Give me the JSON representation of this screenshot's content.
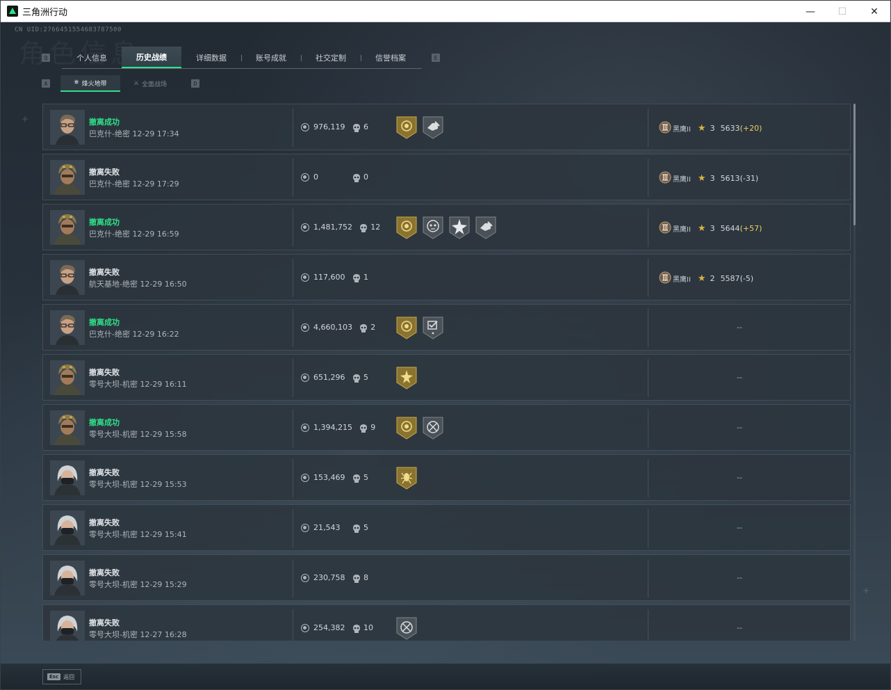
{
  "window": {
    "title": "三角洲行动",
    "minimize": "—",
    "maximize": "☐",
    "close": "✕"
  },
  "uid": "CN UID:2766451554683787500",
  "watermark": "角色信息",
  "keys": {
    "left_tab": "Q",
    "right_tab": "E",
    "left_sub": "A",
    "right_sub": "D"
  },
  "tabs": [
    {
      "label": "个人信息",
      "active": false
    },
    {
      "label": "历史战绩",
      "active": true
    },
    {
      "label": "详细数据",
      "active": false
    },
    {
      "label": "账号成就",
      "active": false
    },
    {
      "label": "社交定制",
      "active": false
    },
    {
      "label": "信誉档案",
      "active": false
    }
  ],
  "subtabs": [
    {
      "label": "烽火地带",
      "glyph": "⛯",
      "active": true
    },
    {
      "label": "全面战场",
      "glyph": "⚔",
      "active": false
    }
  ],
  "colors": {
    "accent": "#2fe08a",
    "gold": "#d9b441",
    "score_up": "#e8cf61"
  },
  "records": [
    {
      "avatar": "glasses",
      "status": "撤离成功",
      "success": true,
      "map": "巴克什-绝密 12-29 17:34",
      "money": "976,119",
      "kills": "6",
      "badges": [
        "gold-shield",
        "gray-hand"
      ],
      "rank": "黑鹰II",
      "stars": "3",
      "score": "5633",
      "delta": "(+20)",
      "delta_up": true
    },
    {
      "avatar": "helmet",
      "status": "撤离失败",
      "success": false,
      "map": "巴克什-绝密 12-29 17:29",
      "money": "0",
      "kills": "0",
      "badges": [],
      "rank": "黑鹰II",
      "stars": "3",
      "score": "5613",
      "delta": "(-31)",
      "delta_up": false
    },
    {
      "avatar": "helmet",
      "status": "撤离成功",
      "success": true,
      "map": "巴克什-绝密 12-29 16:59",
      "money": "1,481,752",
      "kills": "12",
      "badges": [
        "gold-shield",
        "gray-skull",
        "gray-star",
        "gray-hand"
      ],
      "rank": "黑鹰II",
      "stars": "3",
      "score": "5644",
      "delta": "(+57)",
      "delta_up": true
    },
    {
      "avatar": "glasses",
      "status": "撤离失败",
      "success": false,
      "map": "航天基地-绝密 12-29 16:50",
      "money": "117,600",
      "kills": "1",
      "badges": [],
      "rank": "黑鹰II",
      "stars": "2",
      "score": "5587",
      "delta": "(-5)",
      "delta_up": false
    },
    {
      "avatar": "glasses",
      "status": "撤离成功",
      "success": true,
      "map": "巴克什-绝密 12-29 16:22",
      "money": "4,660,103",
      "kills": "2",
      "badges": [
        "gold-shield",
        "gray-check"
      ],
      "rank": "",
      "stars": "",
      "score": "--",
      "delta": "",
      "delta_up": false
    },
    {
      "avatar": "helmet",
      "status": "撤离失败",
      "success": false,
      "map": "零号大坝-机密 12-29 16:11",
      "money": "651,296",
      "kills": "5",
      "badges": [
        "gold-burst"
      ],
      "rank": "",
      "stars": "",
      "score": "--",
      "delta": "",
      "delta_up": false
    },
    {
      "avatar": "helmet",
      "status": "撤离成功",
      "success": true,
      "map": "零号大坝-机密 12-29 15:58",
      "money": "1,394,215",
      "kills": "9",
      "badges": [
        "gold-shield",
        "gray-cross"
      ],
      "rank": "",
      "stars": "",
      "score": "--",
      "delta": "",
      "delta_up": false
    },
    {
      "avatar": "mask",
      "status": "撤离失败",
      "success": false,
      "map": "零号大坝-机密 12-29 15:53",
      "money": "153,469",
      "kills": "5",
      "badges": [
        "gold-spider"
      ],
      "rank": "",
      "stars": "",
      "score": "--",
      "delta": "",
      "delta_up": false
    },
    {
      "avatar": "mask",
      "status": "撤离失败",
      "success": false,
      "map": "零号大坝-机密 12-29 15:41",
      "money": "21,543",
      "kills": "5",
      "badges": [],
      "rank": "",
      "stars": "",
      "score": "--",
      "delta": "",
      "delta_up": false
    },
    {
      "avatar": "mask",
      "status": "撤离失败",
      "success": false,
      "map": "零号大坝-机密 12-29 15:29",
      "money": "230,758",
      "kills": "8",
      "badges": [],
      "rank": "",
      "stars": "",
      "score": "--",
      "delta": "",
      "delta_up": false
    },
    {
      "avatar": "mask",
      "status": "撤离失败",
      "success": false,
      "map": "零号大坝-机密 12-27 16:28",
      "money": "254,382",
      "kills": "10",
      "badges": [
        "gray-cross"
      ],
      "rank": "",
      "stars": "",
      "score": "--",
      "delta": "",
      "delta_up": false
    }
  ],
  "footer": {
    "esc_key": "Esc",
    "esc_label": "返回"
  }
}
